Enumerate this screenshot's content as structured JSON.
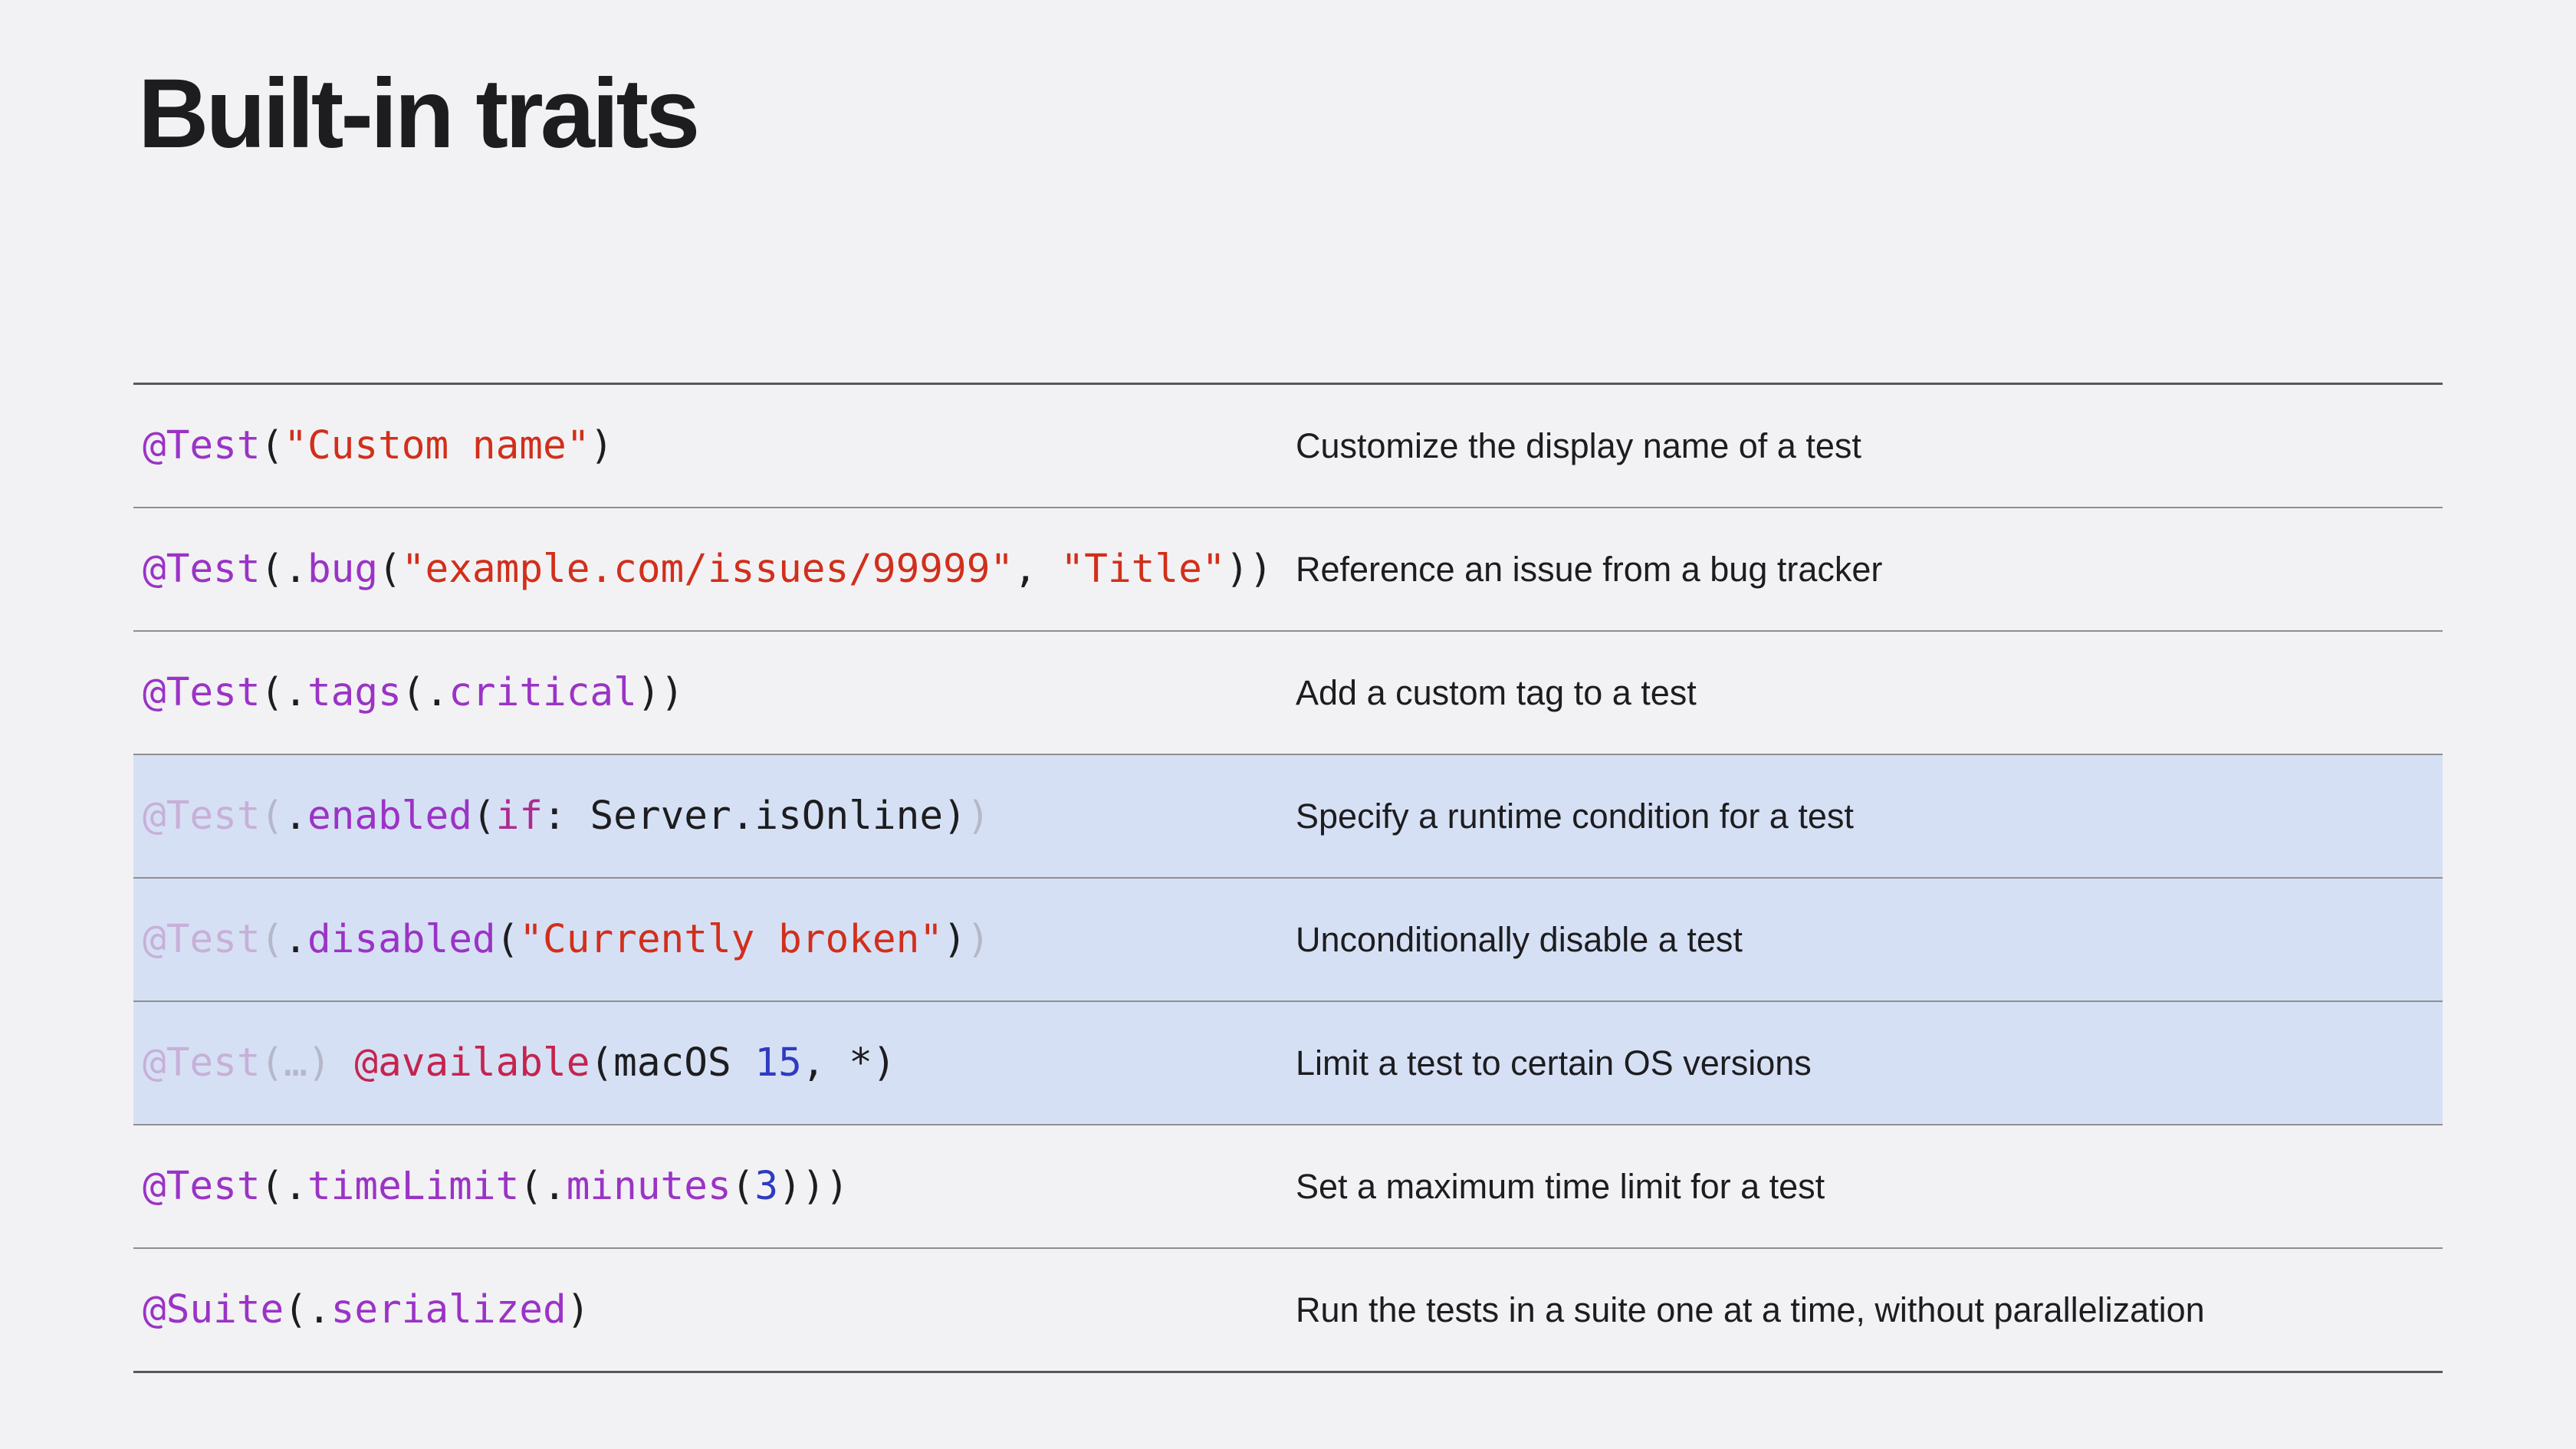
{
  "title": "Built-in traits",
  "rows": [
    {
      "highlighted": false,
      "tokens": [
        {
          "text": "@Test",
          "kind": "attr"
        },
        {
          "text": "(",
          "kind": "punc"
        },
        {
          "text": "\"Custom name\"",
          "kind": "str"
        },
        {
          "text": ")",
          "kind": "punc"
        }
      ],
      "description": "Customize the display name of a test"
    },
    {
      "highlighted": false,
      "tokens": [
        {
          "text": "@Test",
          "kind": "attr"
        },
        {
          "text": "(.",
          "kind": "punc"
        },
        {
          "text": "bug",
          "kind": "method"
        },
        {
          "text": "(",
          "kind": "punc"
        },
        {
          "text": "\"example.com/issues/99999\"",
          "kind": "str"
        },
        {
          "text": ", ",
          "kind": "punc"
        },
        {
          "text": "\"Title\"",
          "kind": "str"
        },
        {
          "text": "))",
          "kind": "punc"
        }
      ],
      "description": "Reference an issue from a bug tracker"
    },
    {
      "highlighted": false,
      "tokens": [
        {
          "text": "@Test",
          "kind": "attr"
        },
        {
          "text": "(.",
          "kind": "punc"
        },
        {
          "text": "tags",
          "kind": "method"
        },
        {
          "text": "(.",
          "kind": "punc"
        },
        {
          "text": "critical",
          "kind": "method"
        },
        {
          "text": "))",
          "kind": "punc"
        }
      ],
      "description": "Add a custom tag to a test"
    },
    {
      "highlighted": true,
      "tokens": [
        {
          "text": "@Test",
          "kind": "faded"
        },
        {
          "text": "(",
          "kind": "faded-punc"
        },
        {
          "text": ".",
          "kind": "punc"
        },
        {
          "text": "enabled",
          "kind": "method"
        },
        {
          "text": "(",
          "kind": "punc"
        },
        {
          "text": "if",
          "kind": "kw"
        },
        {
          "text": ": Server.isOnline)",
          "kind": "plain"
        },
        {
          "text": ")",
          "kind": "faded-punc"
        }
      ],
      "description": "Specify a runtime condition for a test"
    },
    {
      "highlighted": true,
      "tokens": [
        {
          "text": "@Test",
          "kind": "faded"
        },
        {
          "text": "(",
          "kind": "faded-punc"
        },
        {
          "text": ".",
          "kind": "punc"
        },
        {
          "text": "disabled",
          "kind": "method"
        },
        {
          "text": "(",
          "kind": "punc"
        },
        {
          "text": "\"Currently broken\"",
          "kind": "str"
        },
        {
          "text": ")",
          "kind": "punc"
        },
        {
          "text": ")",
          "kind": "faded-punc"
        }
      ],
      "description": "Unconditionally disable a test"
    },
    {
      "highlighted": true,
      "tokens": [
        {
          "text": "@Test",
          "kind": "faded"
        },
        {
          "text": "(…)",
          "kind": "faded-punc"
        },
        {
          "text": " ",
          "kind": "plain"
        },
        {
          "text": "@available",
          "kind": "avail"
        },
        {
          "text": "(macOS ",
          "kind": "plain"
        },
        {
          "text": "15",
          "kind": "num"
        },
        {
          "text": ", *)",
          "kind": "plain"
        }
      ],
      "description": "Limit a test to certain OS versions"
    },
    {
      "highlighted": false,
      "tokens": [
        {
          "text": "@Test",
          "kind": "attr"
        },
        {
          "text": "(.",
          "kind": "punc"
        },
        {
          "text": "timeLimit",
          "kind": "method"
        },
        {
          "text": "(.",
          "kind": "punc"
        },
        {
          "text": "minutes",
          "kind": "method"
        },
        {
          "text": "(",
          "kind": "punc"
        },
        {
          "text": "3",
          "kind": "num"
        },
        {
          "text": ")))",
          "kind": "punc"
        }
      ],
      "description": "Set a maximum time limit for a test"
    },
    {
      "highlighted": false,
      "tokens": [
        {
          "text": "@Suite",
          "kind": "attr"
        },
        {
          "text": "(.",
          "kind": "punc"
        },
        {
          "text": "serialized",
          "kind": "method"
        },
        {
          "text": ")",
          "kind": "punc"
        }
      ],
      "description": "Run the tests in a suite one at a time, without parallelization"
    }
  ],
  "colors": {
    "background": "#f2f2f4",
    "highlight_row": "#d6e0f5",
    "attribute": "#9b33c6",
    "string": "#d12f1b",
    "keyword": "#ad2a8f",
    "number": "#2f3bc0",
    "available_attribute": "#c4244f",
    "text": "#1d1d1f"
  }
}
